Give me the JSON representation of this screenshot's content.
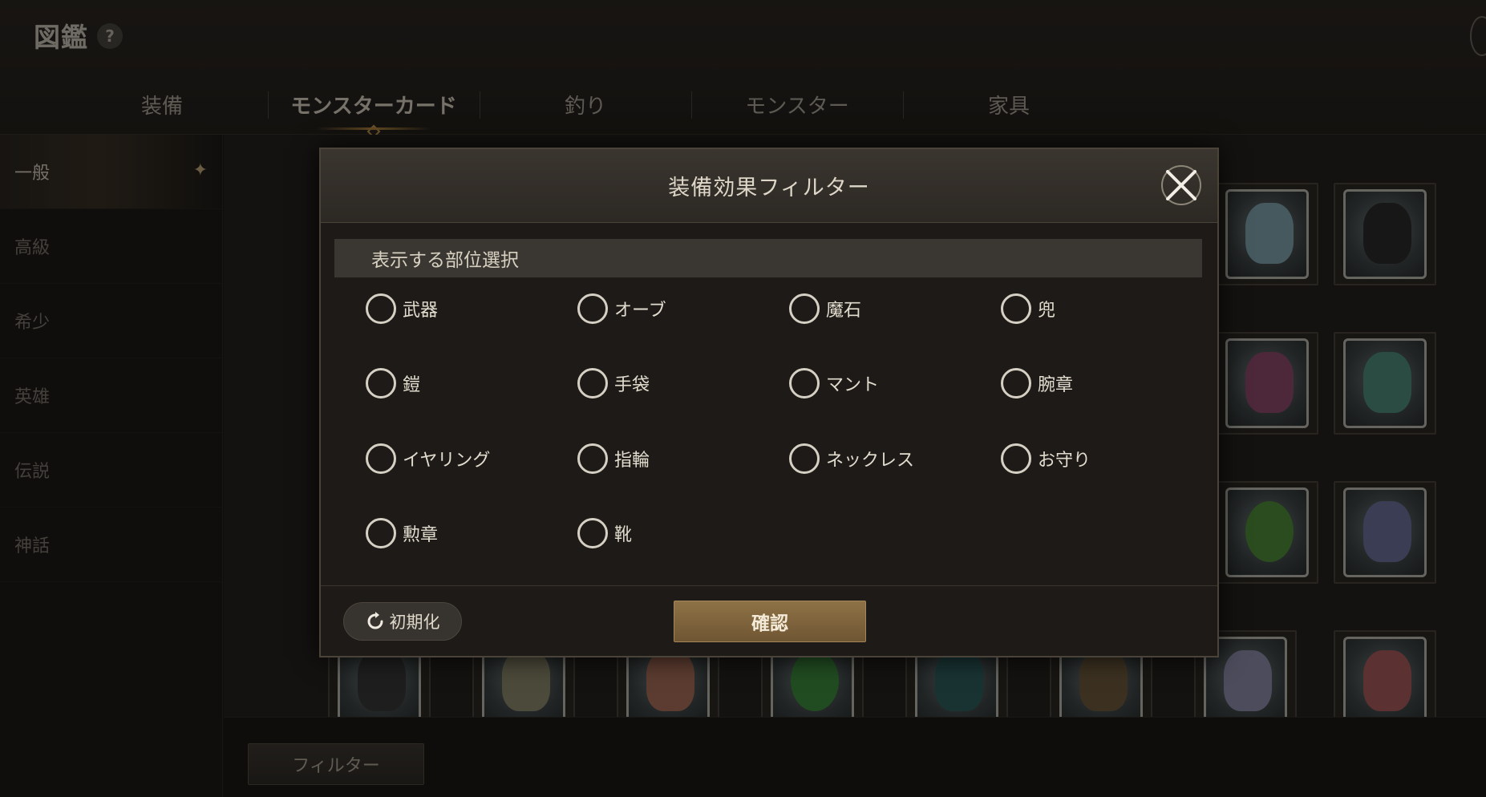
{
  "header": {
    "title": "図鑑",
    "help_label": "?"
  },
  "tabs": [
    {
      "label": "装備",
      "active": false
    },
    {
      "label": "モンスターカード",
      "active": true
    },
    {
      "label": "釣り",
      "active": false
    },
    {
      "label": "モンスター",
      "active": false
    },
    {
      "label": "家具",
      "active": false
    }
  ],
  "sidebar": {
    "items": [
      {
        "label": "一般",
        "active": true
      },
      {
        "label": "高級",
        "active": false
      },
      {
        "label": "希少",
        "active": false
      },
      {
        "label": "英雄",
        "active": false
      },
      {
        "label": "伝説",
        "active": false
      },
      {
        "label": "神話",
        "active": false
      }
    ]
  },
  "bottom": {
    "filter_label": "フィルター"
  },
  "modal": {
    "title": "装備効果フィルター",
    "section_title": "表示する部位選択",
    "options": [
      {
        "label": "武器",
        "checked": false
      },
      {
        "label": "オーブ",
        "checked": false
      },
      {
        "label": "魔石",
        "checked": false
      },
      {
        "label": "兜",
        "checked": false
      },
      {
        "label": "鎧",
        "checked": false
      },
      {
        "label": "手袋",
        "checked": false
      },
      {
        "label": "マント",
        "checked": false
      },
      {
        "label": "腕章",
        "checked": false
      },
      {
        "label": "イヤリング",
        "checked": false
      },
      {
        "label": "指輪",
        "checked": false
      },
      {
        "label": "ネックレス",
        "checked": false
      },
      {
        "label": "お守り",
        "checked": false
      },
      {
        "label": "勲章",
        "checked": false
      },
      {
        "label": "靴",
        "checked": false
      }
    ],
    "reset_label": "初期化",
    "confirm_label": "確認"
  },
  "colors": {
    "accent_gold": "#b8893f",
    "confirm_button": "#8e7246"
  }
}
